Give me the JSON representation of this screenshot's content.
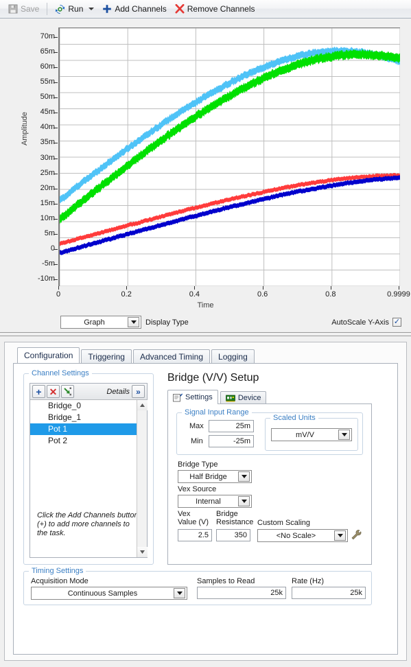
{
  "toolbar": {
    "save_label": "Save",
    "run_label": "Run",
    "add_channels_label": "Add Channels",
    "remove_channels_label": "Remove Channels",
    "save_icon": "floppy-disk-icon",
    "run_icon": "refresh-arrows-icon",
    "add_icon": "plus-icon",
    "remove_icon": "red-x-icon"
  },
  "graph": {
    "y_axis_title": "Amplitude",
    "x_axis_title": "Time",
    "y_ticks": [
      "70m",
      "65m",
      "60m",
      "55m",
      "50m",
      "45m",
      "40m",
      "35m",
      "30m",
      "25m",
      "20m",
      "15m",
      "10m",
      "5m",
      "0",
      "-5m",
      "-10m"
    ],
    "x_ticks": [
      "0",
      "0.2",
      "0.4",
      "0.6",
      "0.8",
      "0.9999"
    ],
    "display_type_value": "Graph",
    "display_type_label": "Display Type",
    "autoscale_label": "AutoScale Y-Axis",
    "autoscale_checked": "✓"
  },
  "chart_data": {
    "type": "line",
    "title": "",
    "xlabel": "Time",
    "ylabel": "Amplitude",
    "xlim": [
      0,
      0.9999
    ],
    "ylim": [
      -0.01,
      0.07
    ],
    "grid": true,
    "legend": "none",
    "x": [
      0.0,
      0.05,
      0.1,
      0.15,
      0.2,
      0.25,
      0.3,
      0.35,
      0.4,
      0.45,
      0.5,
      0.55,
      0.6,
      0.65,
      0.7,
      0.75,
      0.8,
      0.85,
      0.9,
      0.95,
      0.9999
    ],
    "series": [
      {
        "name": "Bridge_0",
        "color": "#4FC3F7",
        "band": 0.002,
        "values": [
          0.0168,
          0.0208,
          0.0248,
          0.0288,
          0.0327,
          0.0365,
          0.0402,
          0.0437,
          0.047,
          0.0501,
          0.053,
          0.0556,
          0.0579,
          0.0598,
          0.0613,
          0.0623,
          0.0628,
          0.0628,
          0.0623,
          0.0612,
          0.0598
        ]
      },
      {
        "name": "Bridge_1",
        "color": "#00E000",
        "band": 0.0024,
        "values": [
          0.0108,
          0.015,
          0.0192,
          0.0233,
          0.0274,
          0.0314,
          0.0353,
          0.039,
          0.0426,
          0.0459,
          0.049,
          0.0519,
          0.0545,
          0.0568,
          0.0587,
          0.0602,
          0.0612,
          0.0617,
          0.0618,
          0.0614,
          0.0607
        ]
      },
      {
        "name": "Pot 1",
        "color": "#FF3B3B",
        "band": 0.0012,
        "values": [
          0.0032,
          0.0046,
          0.006,
          0.0074,
          0.0088,
          0.0102,
          0.0116,
          0.013,
          0.0143,
          0.0156,
          0.0169,
          0.0181,
          0.0192,
          0.0203,
          0.0213,
          0.0221,
          0.0229,
          0.0235,
          0.0239,
          0.0242,
          0.0243
        ]
      },
      {
        "name": "Pot 2",
        "color": "#0000CC",
        "band": 0.0013,
        "values": [
          0.0004,
          0.0018,
          0.0033,
          0.0047,
          0.0062,
          0.0076,
          0.009,
          0.0104,
          0.0118,
          0.0132,
          0.0145,
          0.0158,
          0.017,
          0.0182,
          0.0193,
          0.0203,
          0.0212,
          0.022,
          0.0227,
          0.0232,
          0.0236
        ]
      }
    ]
  },
  "tabs": [
    {
      "label": "Configuration",
      "active": true
    },
    {
      "label": "Triggering",
      "active": false
    },
    {
      "label": "Advanced Timing",
      "active": false
    },
    {
      "label": "Logging",
      "active": false
    }
  ],
  "channel_settings": {
    "group_label": "Channel Settings",
    "add_btn": "+",
    "delete_btn": "✕",
    "move_btn": "move-channel-icon",
    "details_label": "Details",
    "expand_btn": "»",
    "items": [
      {
        "label": "Bridge_0",
        "selected": false
      },
      {
        "label": "Bridge_1",
        "selected": false
      },
      {
        "label": "Pot 1",
        "selected": true
      },
      {
        "label": "Pot 2",
        "selected": false
      }
    ],
    "hint": "Click the Add Channels button (+) to add more channels to the task.",
    "selection_color": "#1f9ae8"
  },
  "setup": {
    "title": "Bridge (V/V) Setup",
    "inner_tabs": [
      {
        "label": "Settings",
        "icon": "settings-document-icon",
        "active": true
      },
      {
        "label": "Device",
        "icon": "device-board-icon",
        "active": false
      }
    ],
    "signal_input_range": {
      "group_label": "Signal Input Range",
      "max_label": "Max",
      "max_value": "25m",
      "min_label": "Min",
      "min_value": "-25m"
    },
    "scaled_units": {
      "group_label": "Scaled Units",
      "value": "mV/V"
    },
    "bridge_type": {
      "label": "Bridge Type",
      "value": "Half Bridge"
    },
    "vex_source": {
      "label": "Vex Source",
      "value": "Internal"
    },
    "vex_value": {
      "label_line1": "Vex",
      "label_line2": "Value (V)",
      "value": "2.5"
    },
    "bridge_resistance": {
      "label_line1": "Bridge",
      "label_line2": "Resistance",
      "value": "350"
    },
    "custom_scaling": {
      "label": "Custom Scaling",
      "value": "<No Scale>",
      "edit_icon": "wrench-icon"
    }
  },
  "timing_settings": {
    "group_label": "Timing Settings",
    "acquisition_mode_label": "Acquisition Mode",
    "acquisition_mode_value": "Continuous Samples",
    "samples_to_read_label": "Samples to Read",
    "samples_to_read_value": "25k",
    "rate_label": "Rate (Hz)",
    "rate_value": "25k"
  }
}
